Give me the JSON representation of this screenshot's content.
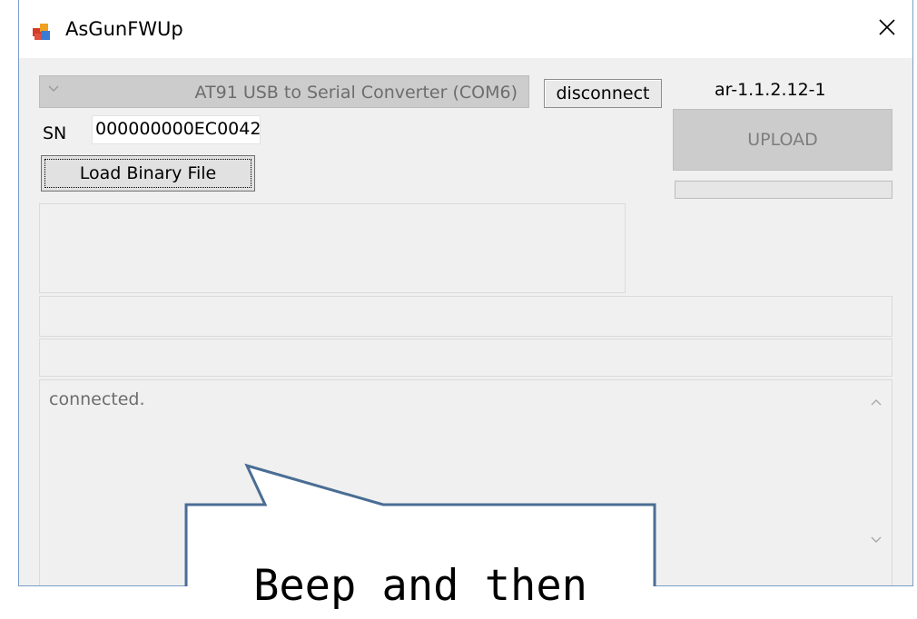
{
  "window": {
    "title": "AsGunFWUp",
    "icons": {
      "app": "app-icon",
      "close": "close-icon"
    }
  },
  "connection": {
    "port_select_value": "AT91 USB to Serial Converter (COM6)",
    "disconnect_label": "disconnect",
    "version": "ar-1.1.2.12-1"
  },
  "serial": {
    "label": "SN",
    "value": "000000000EC0042"
  },
  "upload": {
    "label": "UPLOAD",
    "progress": 0
  },
  "load_binary_label": "Load Binary File",
  "log": {
    "text": "connected."
  },
  "callout": {
    "text": "Beep and then"
  },
  "colors": {
    "window_bg": "#f0f0f0",
    "callout_border": "#4a6d94",
    "disabled_bg": "#cccccc"
  }
}
